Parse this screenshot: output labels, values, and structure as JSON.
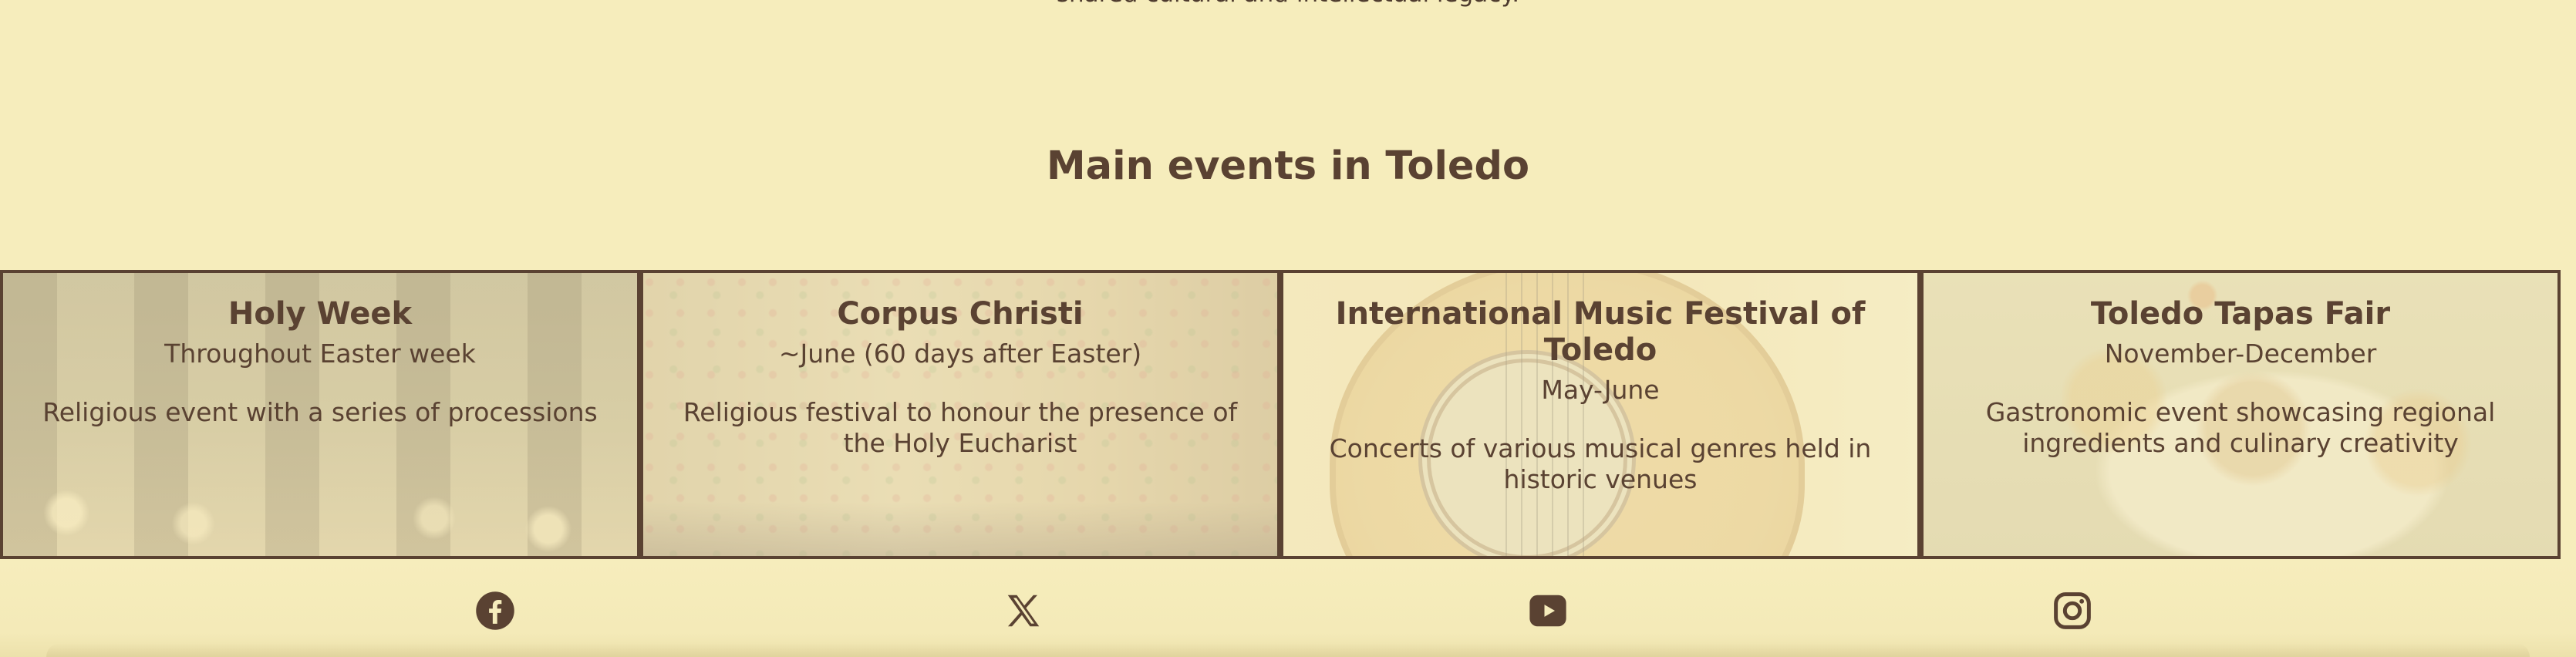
{
  "intro": {
    "tail_text": "shared cultural and intellectual legacy."
  },
  "section": {
    "title": "Main events in Toledo"
  },
  "events": [
    {
      "title": "Holy Week",
      "date": "Throughout Easter week",
      "description": "Religious event with a series of processions"
    },
    {
      "title": "Corpus Christi",
      "date": "~June (60 days after Easter)",
      "description": "Religious festival to honour the presence of the Holy Eucharist"
    },
    {
      "title": "International Music Festival of Toledo",
      "date": "May-June",
      "description": "Concerts of various musical genres held in historic venues"
    },
    {
      "title": "Toledo Tapas Fair",
      "date": "November-December",
      "description": "Gastronomic event showcasing regional ingredients and culinary creativity"
    }
  ],
  "footer": {
    "social": [
      {
        "icon": "facebook-icon"
      },
      {
        "icon": "x-icon"
      },
      {
        "icon": "youtube-icon"
      },
      {
        "icon": "instagram-icon"
      }
    ]
  },
  "colors": {
    "background": "#f6edbc",
    "text": "#5a4232",
    "border": "#5a4232"
  }
}
